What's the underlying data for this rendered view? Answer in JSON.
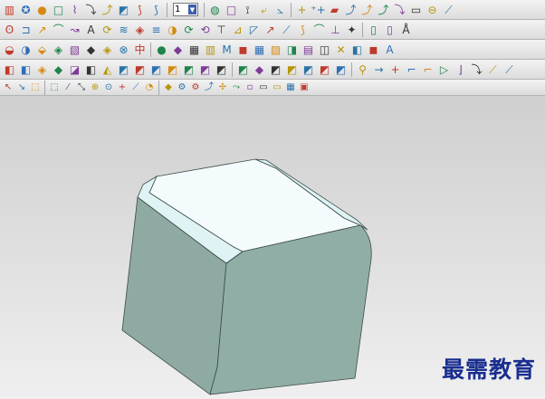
{
  "toolbars": {
    "row1": {
      "groups": [
        [
          "▥",
          "✪",
          "●",
          "□",
          "⌇",
          "⤵",
          "⤴",
          "◩",
          "⟆",
          "⟆"
        ],
        [
          "◍",
          "□",
          "⟟",
          "⤶",
          "⦣"
        ],
        [
          "+",
          "⁺+",
          "▰",
          "⤴",
          "⤴",
          "⤴",
          "⤵",
          "▭",
          "⊖",
          "⟋"
        ]
      ],
      "combo_value": "1"
    },
    "row2": {
      "groups": [
        [
          "ʘ",
          "⊐",
          "↗",
          "⌒",
          "↝",
          "A",
          "⟳",
          "≋",
          "◈",
          "≡",
          "◑",
          "⟳",
          "⟲",
          "⊤",
          "⊿",
          "◸",
          "↗",
          "⟋",
          "⟆",
          "⌒",
          "⊥",
          "✦"
        ],
        [
          "▯",
          "▯",
          "Å"
        ]
      ]
    },
    "row3": {
      "groups": [
        [
          "◒",
          "◑",
          "⬙",
          "◈",
          "▧",
          "◆",
          "◈",
          "⊗",
          "中"
        ],
        [
          "●",
          "◆",
          "▦",
          "▥",
          "M",
          "◼",
          "▦",
          "▨",
          "◨",
          "▤",
          "◫",
          "✕",
          "◧",
          "◼",
          "A"
        ]
      ]
    },
    "row4": {
      "groups": [
        [
          "◧",
          "◧",
          "◈",
          "◆",
          "◪",
          "◧",
          "◭",
          "◩",
          "◩",
          "◩",
          "◩",
          "◩",
          "◩",
          "◩"
        ],
        [
          "◩",
          "◆",
          "◩",
          "◩",
          "◩",
          "◩",
          "◩"
        ],
        [
          "⚲",
          "→",
          "+",
          "⌐",
          "⌐",
          "▷",
          "⌋",
          "⤵",
          "⟋",
          "⟋"
        ]
      ]
    },
    "row5": {
      "groups": [
        [
          "↖",
          "↘",
          "⬚"
        ],
        [
          "⬚",
          "⁄",
          "⤡",
          "⊕",
          "⊙",
          "+",
          "⟋",
          "◔"
        ],
        [
          "◆",
          "⚙",
          "⚙",
          "⤴",
          "✢",
          "⤳",
          "▫",
          "▭",
          "▭",
          "▦",
          "▣"
        ]
      ]
    }
  },
  "viewport": {
    "background_top": "#cfcfcf",
    "background_bottom": "#efefef",
    "model": {
      "top_face_color": "#f4fbfc",
      "chamfer_color": "#dff3f5",
      "side_color": "#91aea6",
      "edge_color": "#3a4a46"
    }
  },
  "watermark": {
    "text": "最需教育",
    "color": "#1a2e8f"
  }
}
